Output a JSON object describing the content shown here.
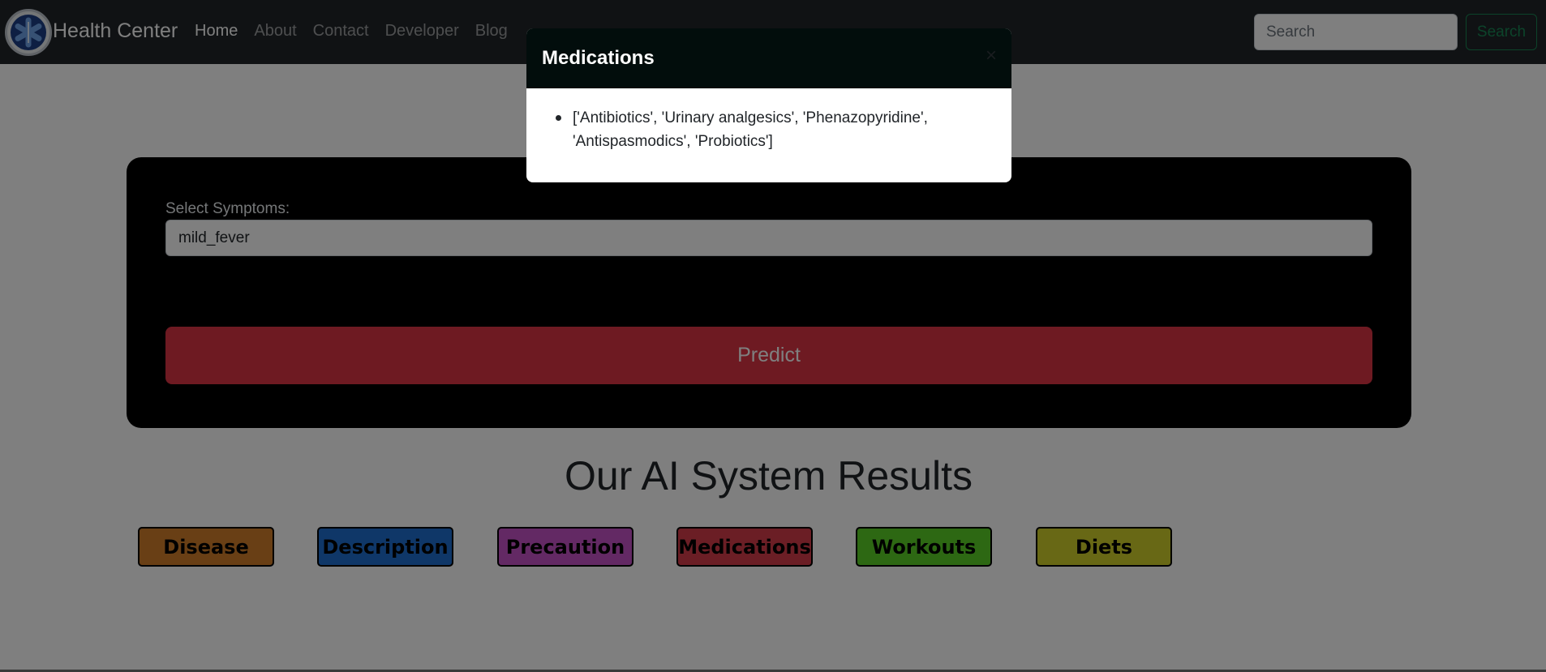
{
  "navbar": {
    "brand": "Health Center",
    "links": [
      "Home",
      "About",
      "Contact",
      "Developer",
      "Blog"
    ],
    "search_placeholder": "Search",
    "search_button": "Search"
  },
  "form": {
    "label": "Select Symptoms:",
    "symptom_value": "mild_fever",
    "predict_label": "Predict"
  },
  "results": {
    "title": "Our AI System Results",
    "buttons": [
      {
        "label": "Disease",
        "color": "#d27e2a"
      },
      {
        "label": "Description",
        "color": "#1f6fd0"
      },
      {
        "label": "Precaution",
        "color": "#c652c8"
      },
      {
        "label": "Medications",
        "color": "#d63d4a"
      },
      {
        "label": "Workouts",
        "color": "#5ad126"
      },
      {
        "label": "Diets",
        "color": "#d1d02a"
      }
    ]
  },
  "modal": {
    "title": "Medications",
    "close_icon": "×",
    "items": [
      "['Antibiotics', 'Urinary analgesics', 'Phenazopyridine', 'Antispasmodics', 'Probiotics']"
    ]
  },
  "colors": {
    "navbar_bg": "#212529",
    "predict_bg": "#dc3545",
    "search_accent": "#198754"
  }
}
